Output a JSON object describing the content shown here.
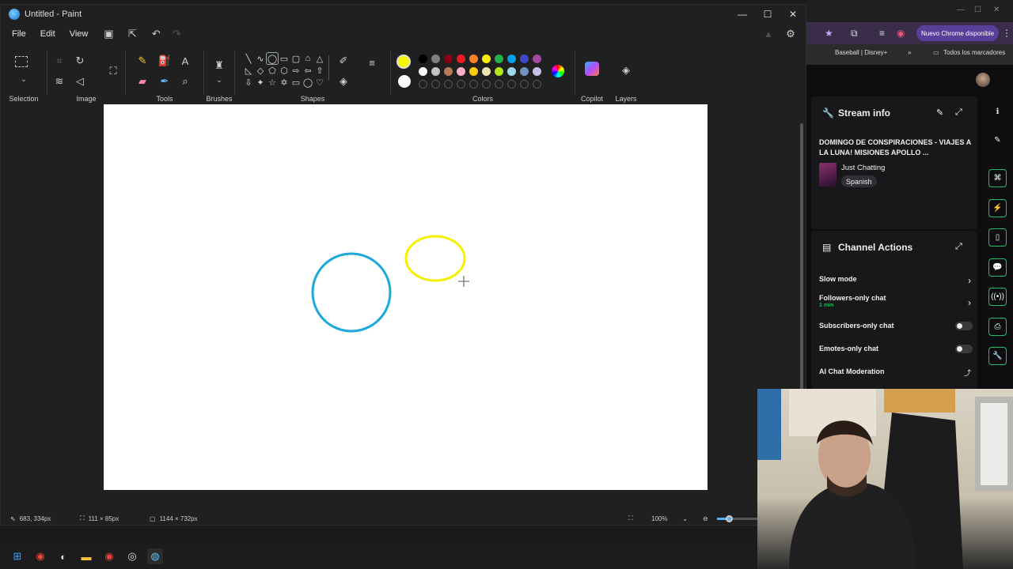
{
  "paint": {
    "window_title": "Untitled - Paint",
    "menu": [
      "File",
      "Edit",
      "View"
    ],
    "groups": {
      "selection": "Selection",
      "image": "Image",
      "tools": "Tools",
      "brushes": "Brushes",
      "shapes": "Shapes",
      "colors": "Colors",
      "copilot": "Copilot",
      "layers": "Layers"
    },
    "active_color": "#f5f500",
    "secondary_color": "#ffffff",
    "palette_row1": [
      "#000000",
      "#7f7f7f",
      "#880015",
      "#ed1c24",
      "#ff7f27",
      "#fff200",
      "#22b14c",
      "#00a2e8",
      "#3f48cc",
      "#a349a4"
    ],
    "palette_row2": [
      "#ffffff",
      "#c3c3c3",
      "#b97a57",
      "#ffaec9",
      "#ffc90e",
      "#efe4b0",
      "#b5e61d",
      "#99d9ea",
      "#7092be",
      "#c8bfe7"
    ],
    "canvas_shapes": [
      {
        "kind": "circle",
        "color": "#1aa9d8"
      },
      {
        "kind": "ellipse",
        "color": "#f5f000"
      }
    ],
    "status": {
      "cursor_pos": "683, 334px",
      "selection_size": "111 × 85px",
      "canvas_size": "1144 × 732px",
      "zoom": "100%"
    }
  },
  "chrome": {
    "update_button": "Nuevo Chrome disponible",
    "bookmark_1": "Baseball | Disney+",
    "bookmark_more": "»",
    "bookmark_folder": "Todos los marcadores"
  },
  "twitch": {
    "stream_info_title": "Stream info",
    "stream_title": "DOMINGO DE CONSPIRACIONES - VIAJES A LA LUNA! MISIONES APOLLO ...",
    "category": "Just Chatting",
    "language_tag": "Spanish",
    "channel_actions_title": "Channel Actions",
    "actions": [
      {
        "label": "Slow mode",
        "sub": ""
      },
      {
        "label": "Followers-only chat",
        "sub": "1 min"
      },
      {
        "label": "Subscribers-only chat",
        "sub": ""
      },
      {
        "label": "Emotes-only chat",
        "sub": ""
      },
      {
        "label": "AI Chat Moderation",
        "sub": ""
      }
    ]
  }
}
